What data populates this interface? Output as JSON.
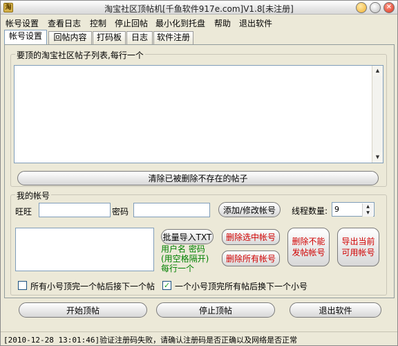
{
  "window": {
    "title": "淘宝社区顶帖机[千鱼软件917e.com]V1.8[未注册]"
  },
  "menu": {
    "items": [
      "帐号设置",
      "查看日志",
      "控制",
      "停止回帖",
      "最小化到托盘",
      "帮助",
      "退出软件"
    ]
  },
  "tabs": [
    "帐号设置",
    "回帖内容",
    "打码板",
    "日志",
    "软件注册"
  ],
  "post_list": {
    "title": "要顶的淘宝社区帖子列表,每行一个",
    "value": "",
    "clear_button": "清除已被删除不存在的帖子"
  },
  "account": {
    "title": "我的帐号",
    "wangwang_label": "旺旺",
    "wangwang_value": "",
    "password_label": "密码",
    "password_value": "",
    "add_button": "添加/修改帐号",
    "threads_label": "线程数量:",
    "threads_value": "9",
    "import_button": "批量导入TXT",
    "import_hint_1": "用户名 密码",
    "import_hint_2": "(用空格隔开)",
    "import_hint_3": "每行一个",
    "delete_selected_button": "删除选中帐号",
    "delete_all_button": "删除所有帐号",
    "delete_cannot_post_line1": "删除不能",
    "delete_cannot_post_line2": "发帖帐号",
    "export_usable_line1": "导出当前",
    "export_usable_line2": "可用帐号",
    "accounts_list_value": ""
  },
  "options": {
    "all_accounts_then_next": {
      "label": "所有小号顶完一个帖后接下一个帖",
      "checked": false
    },
    "one_account_all_posts": {
      "label": "一个小号顶完所有帖后换下一个小号",
      "checked": true
    }
  },
  "actions": {
    "start": "开始顶帖",
    "stop": "停止顶帖",
    "exit": "退出软件"
  },
  "status": {
    "message": "[2010-12-28 13:01:46]验证注册码失败，请确认注册码是否正确以及网络是否正常"
  }
}
